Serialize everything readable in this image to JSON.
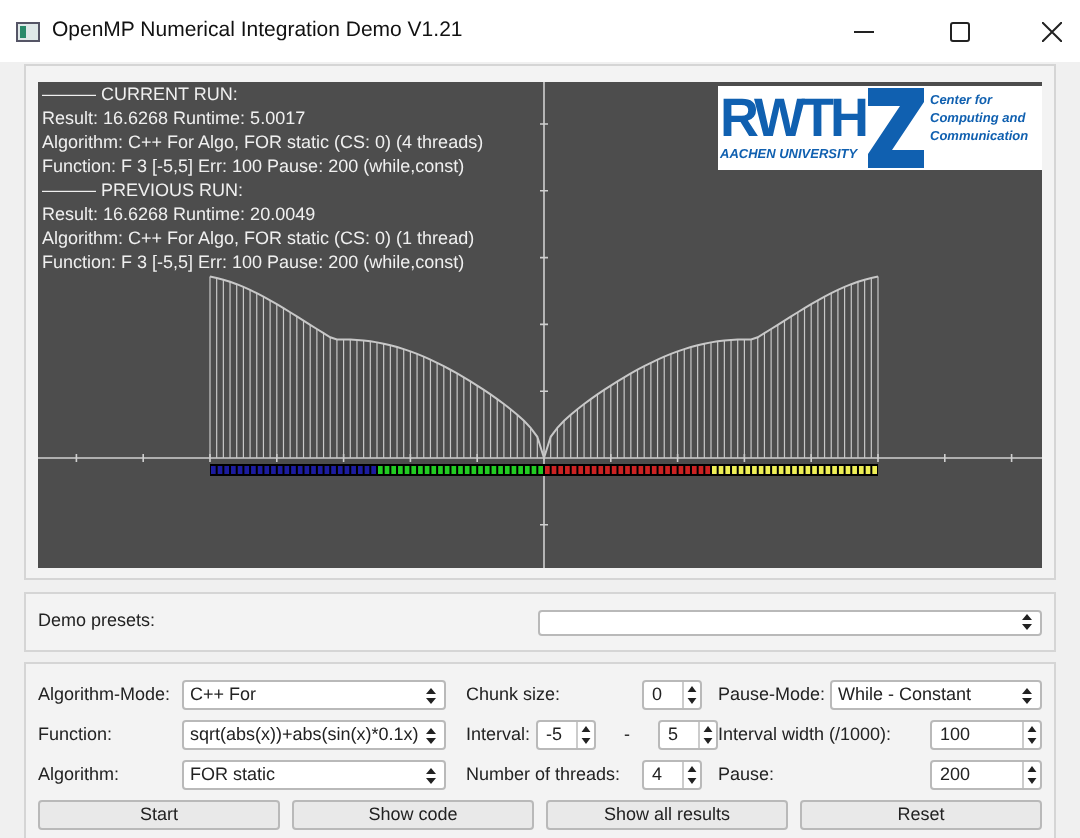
{
  "window": {
    "title": "OpenMP Numerical Integration Demo V1.21"
  },
  "run_info": [
    "——— CURRENT RUN:",
    "Result: 16.6268  Runtime: 5.0017",
    "Algorithm: C++ For Algo, FOR static (CS: 0) (4 threads)",
    "Function: F 3 [-5,5] Err: 100 Pause: 200 (while,const)",
    "——— PREVIOUS RUN:",
    "Result: 16.6268  Runtime: 20.0049",
    "Algorithm: C++ For Algo, FOR static (CS: 0) (1 thread)",
    "Function: F 3 [-5,5] Err: 100 Pause: 200 (while,const)"
  ],
  "logo": {
    "wordmark": "RWTH",
    "subtitle": "AACHEN UNIVERSITY",
    "caption": [
      "Center for",
      "Computing and",
      "Communication"
    ]
  },
  "threads": [
    {
      "color": "#1c1ca0"
    },
    {
      "color": "#22cc22"
    },
    {
      "color": "#cc2222"
    },
    {
      "color": "#eeee55"
    }
  ],
  "demo_presets": {
    "label": "Demo presets:"
  },
  "settings": {
    "algorithm_mode": {
      "label": "Algorithm-Mode:",
      "value": "C++ For"
    },
    "chunk_size": {
      "label": "Chunk size:",
      "value": "0"
    },
    "pause_mode": {
      "label": "Pause-Mode:",
      "value": "While - Constant"
    },
    "function": {
      "label": "Function:",
      "value": "sqrt(abs(x))+abs(sin(x)*0.1x)"
    },
    "interval": {
      "label": "Interval:",
      "from": "-5",
      "separator": "-",
      "to": "5"
    },
    "interval_width": {
      "label": "Interval width (/1000):",
      "value": "100"
    },
    "algorithm": {
      "label": "Algorithm:",
      "value": "FOR static"
    },
    "threads": {
      "label": "Number of threads:",
      "value": "4"
    },
    "pause": {
      "label": "Pause:",
      "value": "200"
    }
  },
  "buttons": [
    "Start",
    "Show code",
    "Show all results",
    "Reset"
  ]
}
